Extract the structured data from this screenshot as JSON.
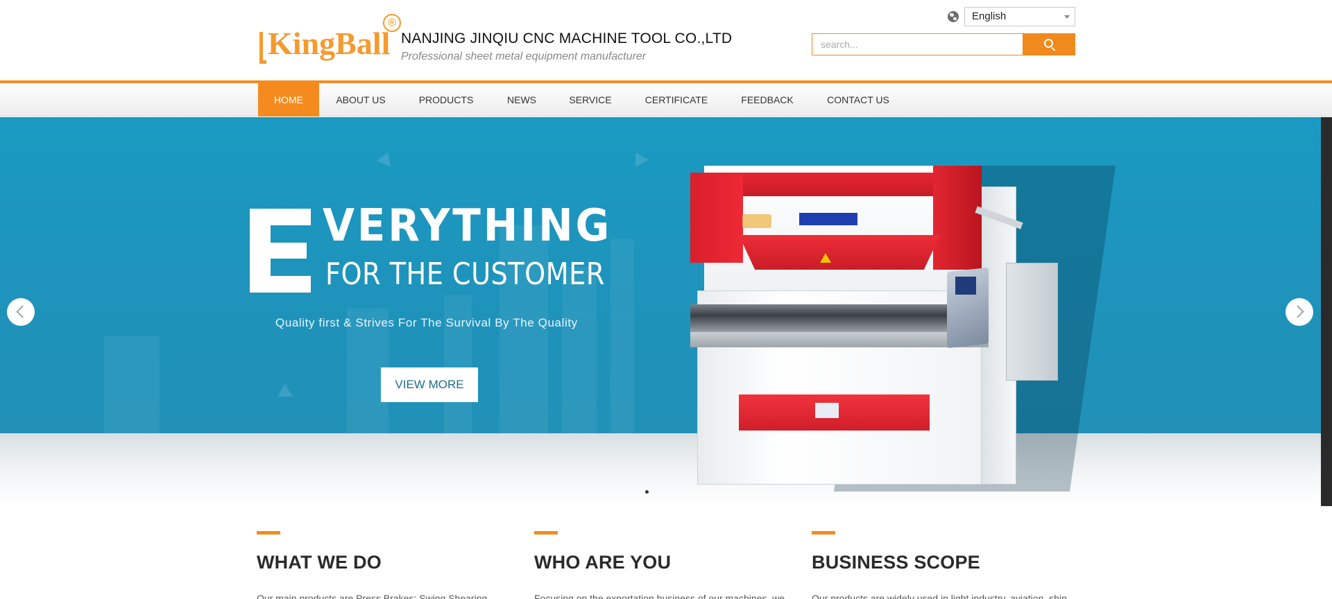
{
  "header": {
    "logo_text": "KingBall",
    "logo_registered": "®",
    "company_name": "NANJING JINQIU CNC MACHINE TOOL CO.,LTD",
    "tagline": "Professional sheet metal equipment manufacturer",
    "language": {
      "selected": "English",
      "icon": "globe-icon"
    },
    "search": {
      "placeholder": "search...",
      "value": "",
      "icon": "search-icon"
    }
  },
  "nav": {
    "items": [
      {
        "label": "HOME",
        "active": true
      },
      {
        "label": "ABOUT US",
        "active": false
      },
      {
        "label": "PRODUCTS",
        "active": false
      },
      {
        "label": "NEWS",
        "active": false
      },
      {
        "label": "SERVICE",
        "active": false
      },
      {
        "label": "CERTIFICATE",
        "active": false
      },
      {
        "label": "FEEDBACK",
        "active": false
      },
      {
        "label": "CONTACT US",
        "active": false
      }
    ]
  },
  "banner": {
    "headline_letter": "E",
    "headline_line1": "VERYTHING",
    "headline_line2": "FOR THE CUSTOMER",
    "subtitle": "Quality  first & Strives For The Survival By The Quality",
    "button_label": "VIEW MORE",
    "prev_icon": "chevron-left-icon",
    "next_icon": "chevron-right-icon",
    "slide_count": 1,
    "current_slide": 1
  },
  "sections": [
    {
      "title": "WHAT WE DO",
      "text": " Our main products are  Press Brakes; Swing Shearing"
    },
    {
      "title": "WHO ARE YOU",
      "text": "Focusing on the exportation business of our machines, we"
    },
    {
      "title": "BUSINESS SCOPE",
      "text": "Our products are widely used in light industry, aviation, ship,"
    }
  ],
  "colors": {
    "accent": "#f58b1f",
    "banner_blue": "#1a9ac2",
    "text_dark": "#2a2a2a"
  }
}
